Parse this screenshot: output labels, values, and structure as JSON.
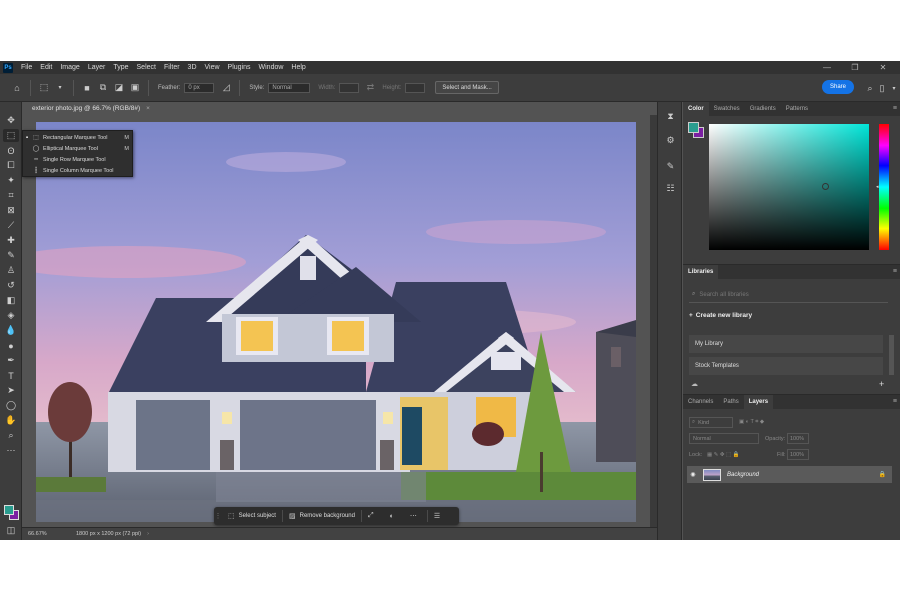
{
  "menubar": {
    "logo": "Ps",
    "items": [
      "File",
      "Edit",
      "Image",
      "Layer",
      "Type",
      "Select",
      "Filter",
      "3D",
      "View",
      "Plugins",
      "Window",
      "Help"
    ],
    "minimize": "—",
    "maximize": "❐",
    "close": "✕"
  },
  "options": {
    "feather_label": "Feather:",
    "feather_value": "0 px",
    "style_label": "Style:",
    "style_value": "Normal",
    "width_label": "Width:",
    "height_label": "Height:",
    "select_mask": "Select and Mask...",
    "share": "Share"
  },
  "document": {
    "tab_title": "exterior photo.jpg @ 66.7% (RGB/8#)",
    "close": "×"
  },
  "tool_flyout": {
    "items": [
      {
        "label": "Rectangular Marquee Tool",
        "key": "M"
      },
      {
        "label": "Elliptical Marquee Tool",
        "key": "M"
      },
      {
        "label": "Single Row Marquee Tool",
        "key": ""
      },
      {
        "label": "Single Column Marquee Tool",
        "key": ""
      }
    ]
  },
  "context_bar": {
    "select_subject": "Select subject",
    "remove_background": "Remove background"
  },
  "status": {
    "zoom": "66.67%",
    "doc_info": "1800 px x 1200 px (72 ppi)"
  },
  "color_panel": {
    "tabs": [
      "Color",
      "Swatches",
      "Gradients",
      "Patterns"
    ],
    "foreground": "#2a9d8f",
    "background": "#7b1fa2"
  },
  "libraries_panel": {
    "tab": "Libraries",
    "search_placeholder": "Search all libraries",
    "create_label": "Create new library",
    "items": [
      "My Library",
      "Stock Templates"
    ]
  },
  "layers_panel": {
    "tabs": [
      "Channels",
      "Paths",
      "Layers"
    ],
    "kind": "Kind",
    "blend_mode": "Normal",
    "opacity_label": "Opacity:",
    "opacity_value": "100%",
    "lock_label": "Lock:",
    "fill_label": "Fill:",
    "fill_value": "100%",
    "layer_name": "Background"
  }
}
